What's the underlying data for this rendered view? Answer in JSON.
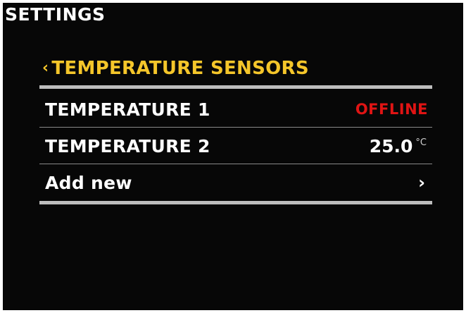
{
  "app": {
    "title": "SETTINGS"
  },
  "section": {
    "back_glyph": "‹",
    "title": "TEMPERATURE SENSORS"
  },
  "sensors": [
    {
      "label": "TEMPERATURE 1",
      "status": "OFFLINE"
    },
    {
      "label": "TEMPERATURE 2",
      "value": "25.0",
      "unit": "°C"
    }
  ],
  "add_new": {
    "label": "Add new",
    "chevron_glyph": "›"
  },
  "colors": {
    "background": "#070707",
    "accent": "#f5c62a",
    "offline": "#e01414",
    "divider": "#bdbdbd"
  },
  "icons": {
    "back": "chevron-left-icon",
    "forward": "chevron-right-icon"
  }
}
